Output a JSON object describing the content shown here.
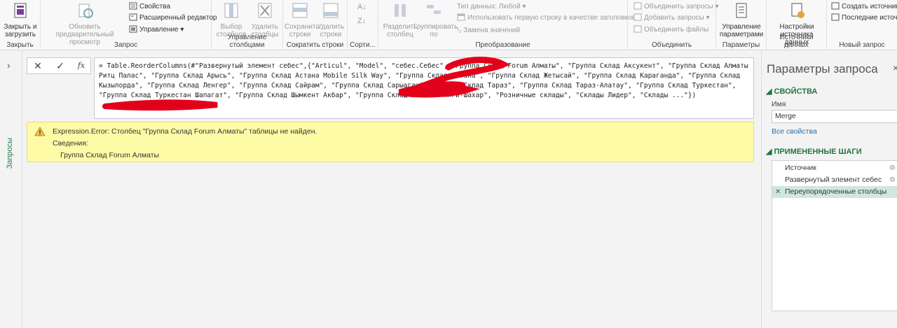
{
  "ribbon": {
    "close_group": {
      "label": "Закрыть",
      "close_load": "Закрыть и\nзагрузить"
    },
    "query_group": {
      "label": "Запрос",
      "refresh_preview": "Обновить предварительный\nпросмотр",
      "properties": "Свойства",
      "advanced_editor": "Расширенный редактор",
      "manage": "Управление"
    },
    "columns_group": {
      "label": "Управление столбцами",
      "choose_columns": "Выбор\nстолбцов",
      "remove_columns": "Удалить\nстолбцы"
    },
    "rows_group": {
      "label": "Сократить строки",
      "keep_rows": "Сохранить\nстроки",
      "remove_rows": "Удалить\nстроки"
    },
    "sort_group": {
      "label": "Сорти..."
    },
    "transform_group": {
      "label": "Преобразование",
      "split_column": "Разделить\nстолбец",
      "group_by": "Группировать\nпо",
      "data_type": "Тип данных: Любой",
      "use_first_row": "Использовать первую строку в качестве заголовков",
      "replace_values": "Замена значений"
    },
    "combine_group": {
      "label": "Объединить",
      "merge_queries": "Объединить запросы",
      "append_queries": "Добавить запросы",
      "combine_files": "Объединить файлы"
    },
    "params_group": {
      "label": "Параметры",
      "manage_params": "Управление\nпараметрами"
    },
    "datasource_group": {
      "label": "Источники данных",
      "datasource_settings": "Настройки\nисточника данных"
    },
    "newquery_group": {
      "label": "Новый запрос",
      "new_source": "Создать источник",
      "recent_sources": "Последние источни..."
    }
  },
  "left_pane": {
    "label": "Запросы"
  },
  "formula": {
    "cancel_icon": "✕",
    "commit_icon": "✓",
    "fx": "fx",
    "text": "= Table.ReorderColumns(#\"Развернутый элемент себес\",{\"Articul\", \"Model\", \"себес.Себес\", \"Группа Склад Forum Алматы\", \"Группа Склад Аксукент\", \"Группа Склад Алматы Ритц Палас\", \"Группа Склад Арысь\", \"Группа Склад Астана Mobile Silk Way\", \"Группа Склад Астана\", \"Группа Склад Жетысай\", \"Группа Склад Караганда\", \"Группа Склад Кызылорда\", \"Группа Склад Ленгер\", \"Группа Склад Сайрам\", \"Группа Склад Сарыагаш\", \"Группа Склад Тараз\", \"Группа Склад Тараз-Алатау\", \"Группа Склад Туркестан\", \"Группа Склад Туркестан Шапагат\", \"Группа Склад Шымкент Акбар\", \"Группа Склад Шымкент Янги-Шахар\", \"Розничные склады\", \"Склады Лидер\", \"Склады ...\"})"
  },
  "error": {
    "message": "Expression.Error: Столбец \"Группа Склад Forum Алматы\" таблицы не найден.",
    "details_label": "Сведения:",
    "details_value": "Группа Склад Forum Алматы"
  },
  "query_settings": {
    "title": "Параметры запроса",
    "close": "×",
    "properties_header": "СВОЙСТВА",
    "name_label": "Имя",
    "name_value": "Merge",
    "all_properties": "Все свойства",
    "applied_steps_header": "ПРИМЕНЕННЫЕ ШАГИ",
    "steps": [
      {
        "label": "Источник",
        "gear": "⚙"
      },
      {
        "label": "Развернутый элемент себес",
        "gear": "⚙"
      },
      {
        "label": "Переупорядоченные столбцы",
        "gear": ""
      }
    ]
  },
  "colors": {
    "accent": "#217346",
    "error_bg": "#fefba6",
    "selected_step": "#cfe8dc",
    "redaction": "#e3001b"
  }
}
